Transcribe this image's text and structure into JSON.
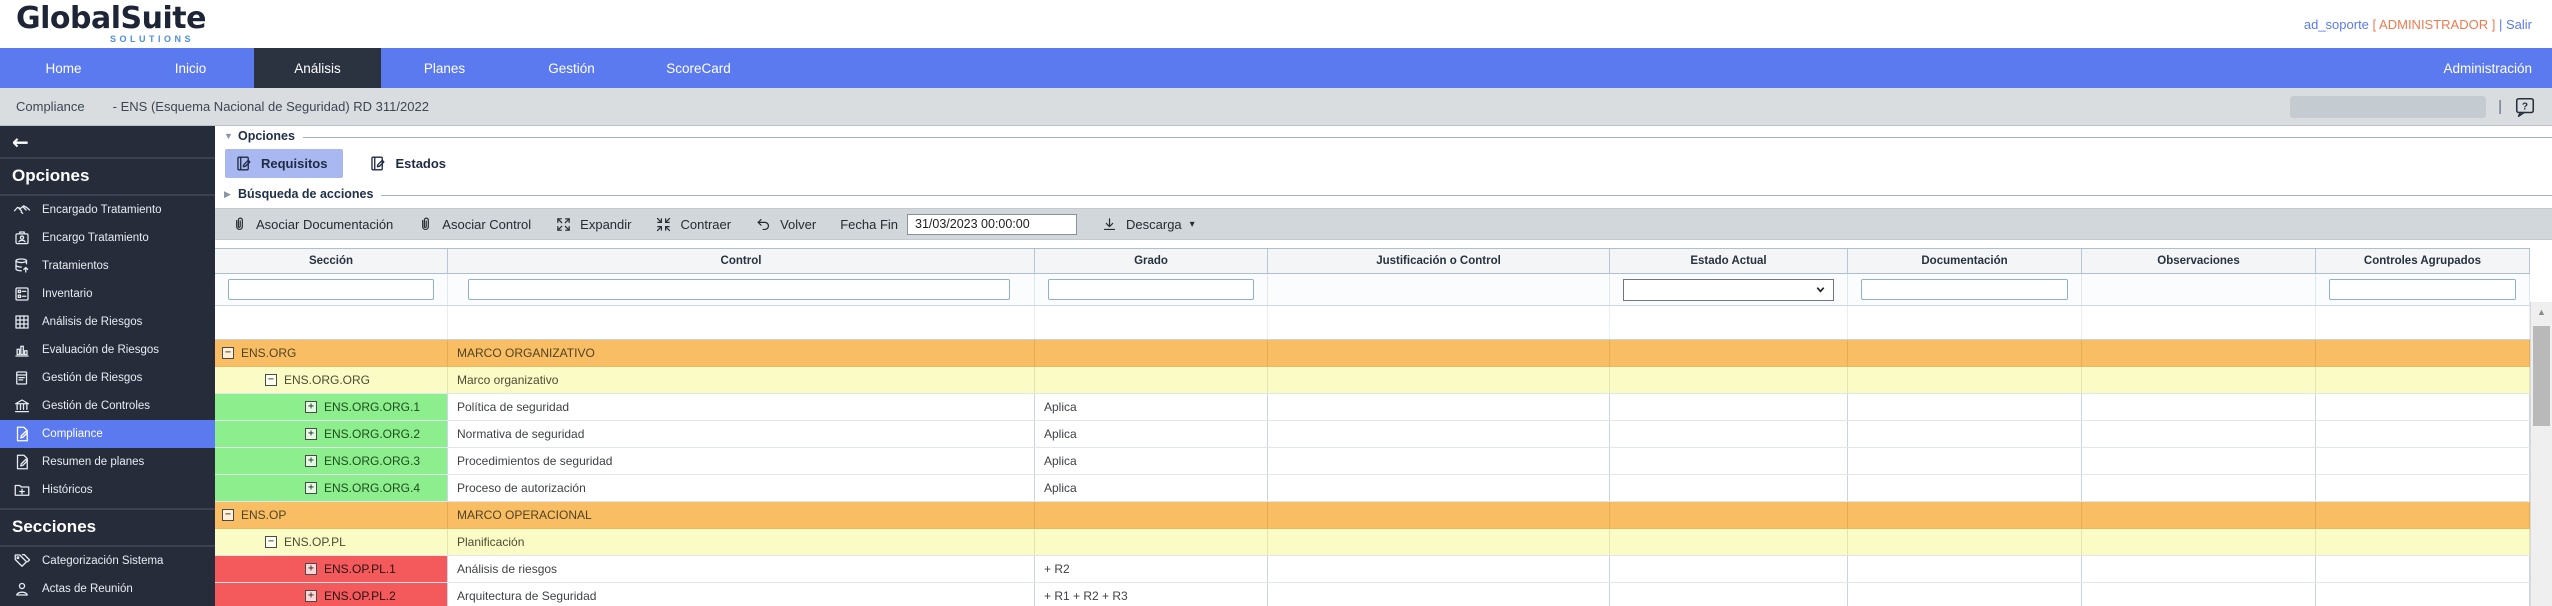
{
  "header": {
    "logo": {
      "title": "GlobalSuite",
      "subtitle": "SOLUTIONS"
    },
    "user": {
      "name": "ad_soporte",
      "role": "[ ADMINISTRADOR ]",
      "separator": "|",
      "logout": "Salir"
    }
  },
  "nav": {
    "items": [
      {
        "label": "Home",
        "active": false
      },
      {
        "label": "Inicio",
        "active": false
      },
      {
        "label": "Análisis",
        "active": true
      },
      {
        "label": "Planes",
        "active": false
      },
      {
        "label": "Gestión",
        "active": false
      },
      {
        "label": "ScoreCard",
        "active": false
      }
    ],
    "right_item": {
      "label": "Administración"
    }
  },
  "breadcrumb": {
    "section": "Compliance",
    "detail": "- ENS (Esquema Nacional de Seguridad) RD 311/2022",
    "pipe": "|"
  },
  "sidebar": {
    "back_icon": "←",
    "sections": [
      {
        "title": "Opciones",
        "items": [
          {
            "label": "Encargado Tratamiento",
            "icon": "handshake-icon",
            "active": false
          },
          {
            "label": "Encargo Tratamiento",
            "icon": "id-badge-icon",
            "active": false
          },
          {
            "label": "Tratamientos",
            "icon": "database-icon",
            "active": false
          },
          {
            "label": "Inventario",
            "icon": "inventory-icon",
            "active": false
          },
          {
            "label": "Análisis de Riesgos",
            "icon": "grid-icon",
            "active": false
          },
          {
            "label": "Evaluación de Riesgos",
            "icon": "bar-chart-icon",
            "active": false
          },
          {
            "label": "Gestión de Riesgos",
            "icon": "document-icon",
            "active": false
          },
          {
            "label": "Gestión de Controles",
            "icon": "bank-icon",
            "active": false
          },
          {
            "label": "Compliance",
            "icon": "page-edit-icon",
            "active": true
          },
          {
            "label": "Resumen de planes",
            "icon": "page-edit-icon",
            "active": false
          },
          {
            "label": "Históricos",
            "icon": "folder-plus-icon",
            "active": false
          }
        ]
      },
      {
        "title": "Secciones",
        "items": [
          {
            "label": "Categorización Sistema",
            "icon": "tags-icon",
            "active": false
          },
          {
            "label": "Actas de Reunión",
            "icon": "person-icon",
            "active": false
          }
        ]
      }
    ]
  },
  "panels": {
    "options": {
      "label": "Opciones",
      "marker": "▼"
    },
    "search": {
      "label": "Búsqueda de acciones",
      "marker": "▶"
    }
  },
  "tabs": [
    {
      "label": "Requisitos",
      "icon": "notebook-edit-icon",
      "active": true
    },
    {
      "label": "Estados",
      "icon": "notebook-edit-icon",
      "active": false
    }
  ],
  "toolbar": {
    "buttons": [
      {
        "label": "Asociar Documentación",
        "icon": "paperclip-icon"
      },
      {
        "label": "Asociar Control",
        "icon": "paperclip-icon"
      },
      {
        "label": "Expandir",
        "icon": "expand-icon"
      },
      {
        "label": "Contraer",
        "icon": "collapse-icon"
      },
      {
        "label": "Volver",
        "icon": "undo-icon"
      }
    ],
    "fecha_fin": {
      "label": "Fecha Fin",
      "value": "31/03/2023 00:00:00"
    },
    "descarga": {
      "label": "Descarga",
      "icon": "download-icon",
      "caret": "▾"
    }
  },
  "table": {
    "columns": [
      "Sección",
      "Control",
      "Grado",
      "Justificación o Control",
      "Estado Actual",
      "Documentación",
      "Observaciones",
      "Controles Agrupados"
    ],
    "rows": [
      {
        "section": "ENS.ORG",
        "toggle": "−",
        "level": 0,
        "color": "orange",
        "control": "MARCO ORGANIZATIVO",
        "grado": ""
      },
      {
        "section": "ENS.ORG.ORG",
        "toggle": "−",
        "level": 1,
        "color": "yellow",
        "control": "Marco organizativo",
        "grado": ""
      },
      {
        "section": "ENS.ORG.ORG.1",
        "toggle": "+",
        "level": 2,
        "color": "green",
        "control": "Política de seguridad",
        "grado": "Aplica"
      },
      {
        "section": "ENS.ORG.ORG.2",
        "toggle": "+",
        "level": 2,
        "color": "green",
        "control": "Normativa de seguridad",
        "grado": "Aplica"
      },
      {
        "section": "ENS.ORG.ORG.3",
        "toggle": "+",
        "level": 2,
        "color": "green",
        "control": "Procedimientos de seguridad",
        "grado": "Aplica"
      },
      {
        "section": "ENS.ORG.ORG.4",
        "toggle": "+",
        "level": 2,
        "color": "green",
        "control": "Proceso de autorización",
        "grado": "Aplica"
      },
      {
        "section": "ENS.OP",
        "toggle": "−",
        "level": 0,
        "color": "orange",
        "control": "MARCO OPERACIONAL",
        "grado": ""
      },
      {
        "section": "ENS.OP.PL",
        "toggle": "−",
        "level": 1,
        "color": "yellow",
        "control": "Planificación",
        "grado": ""
      },
      {
        "section": "ENS.OP.PL.1",
        "toggle": "+",
        "level": 2,
        "color": "red",
        "control": "Análisis de riesgos",
        "grado": "+ R2"
      },
      {
        "section": "ENS.OP.PL.2",
        "toggle": "+",
        "level": 2,
        "color": "red",
        "control": "Arquitectura de Seguridad",
        "grado": "+ R1 + R2 + R3"
      }
    ]
  },
  "scrollbar": {
    "up_arrow": "▲"
  },
  "colors": {
    "nav_blue": "#5b7af0",
    "accent_orange": "#ee7a50",
    "orange_row": "#f9be63",
    "yellow_row": "#fbfbc6",
    "green_cell": "#8cee8c",
    "red_cell": "#f4595b"
  }
}
